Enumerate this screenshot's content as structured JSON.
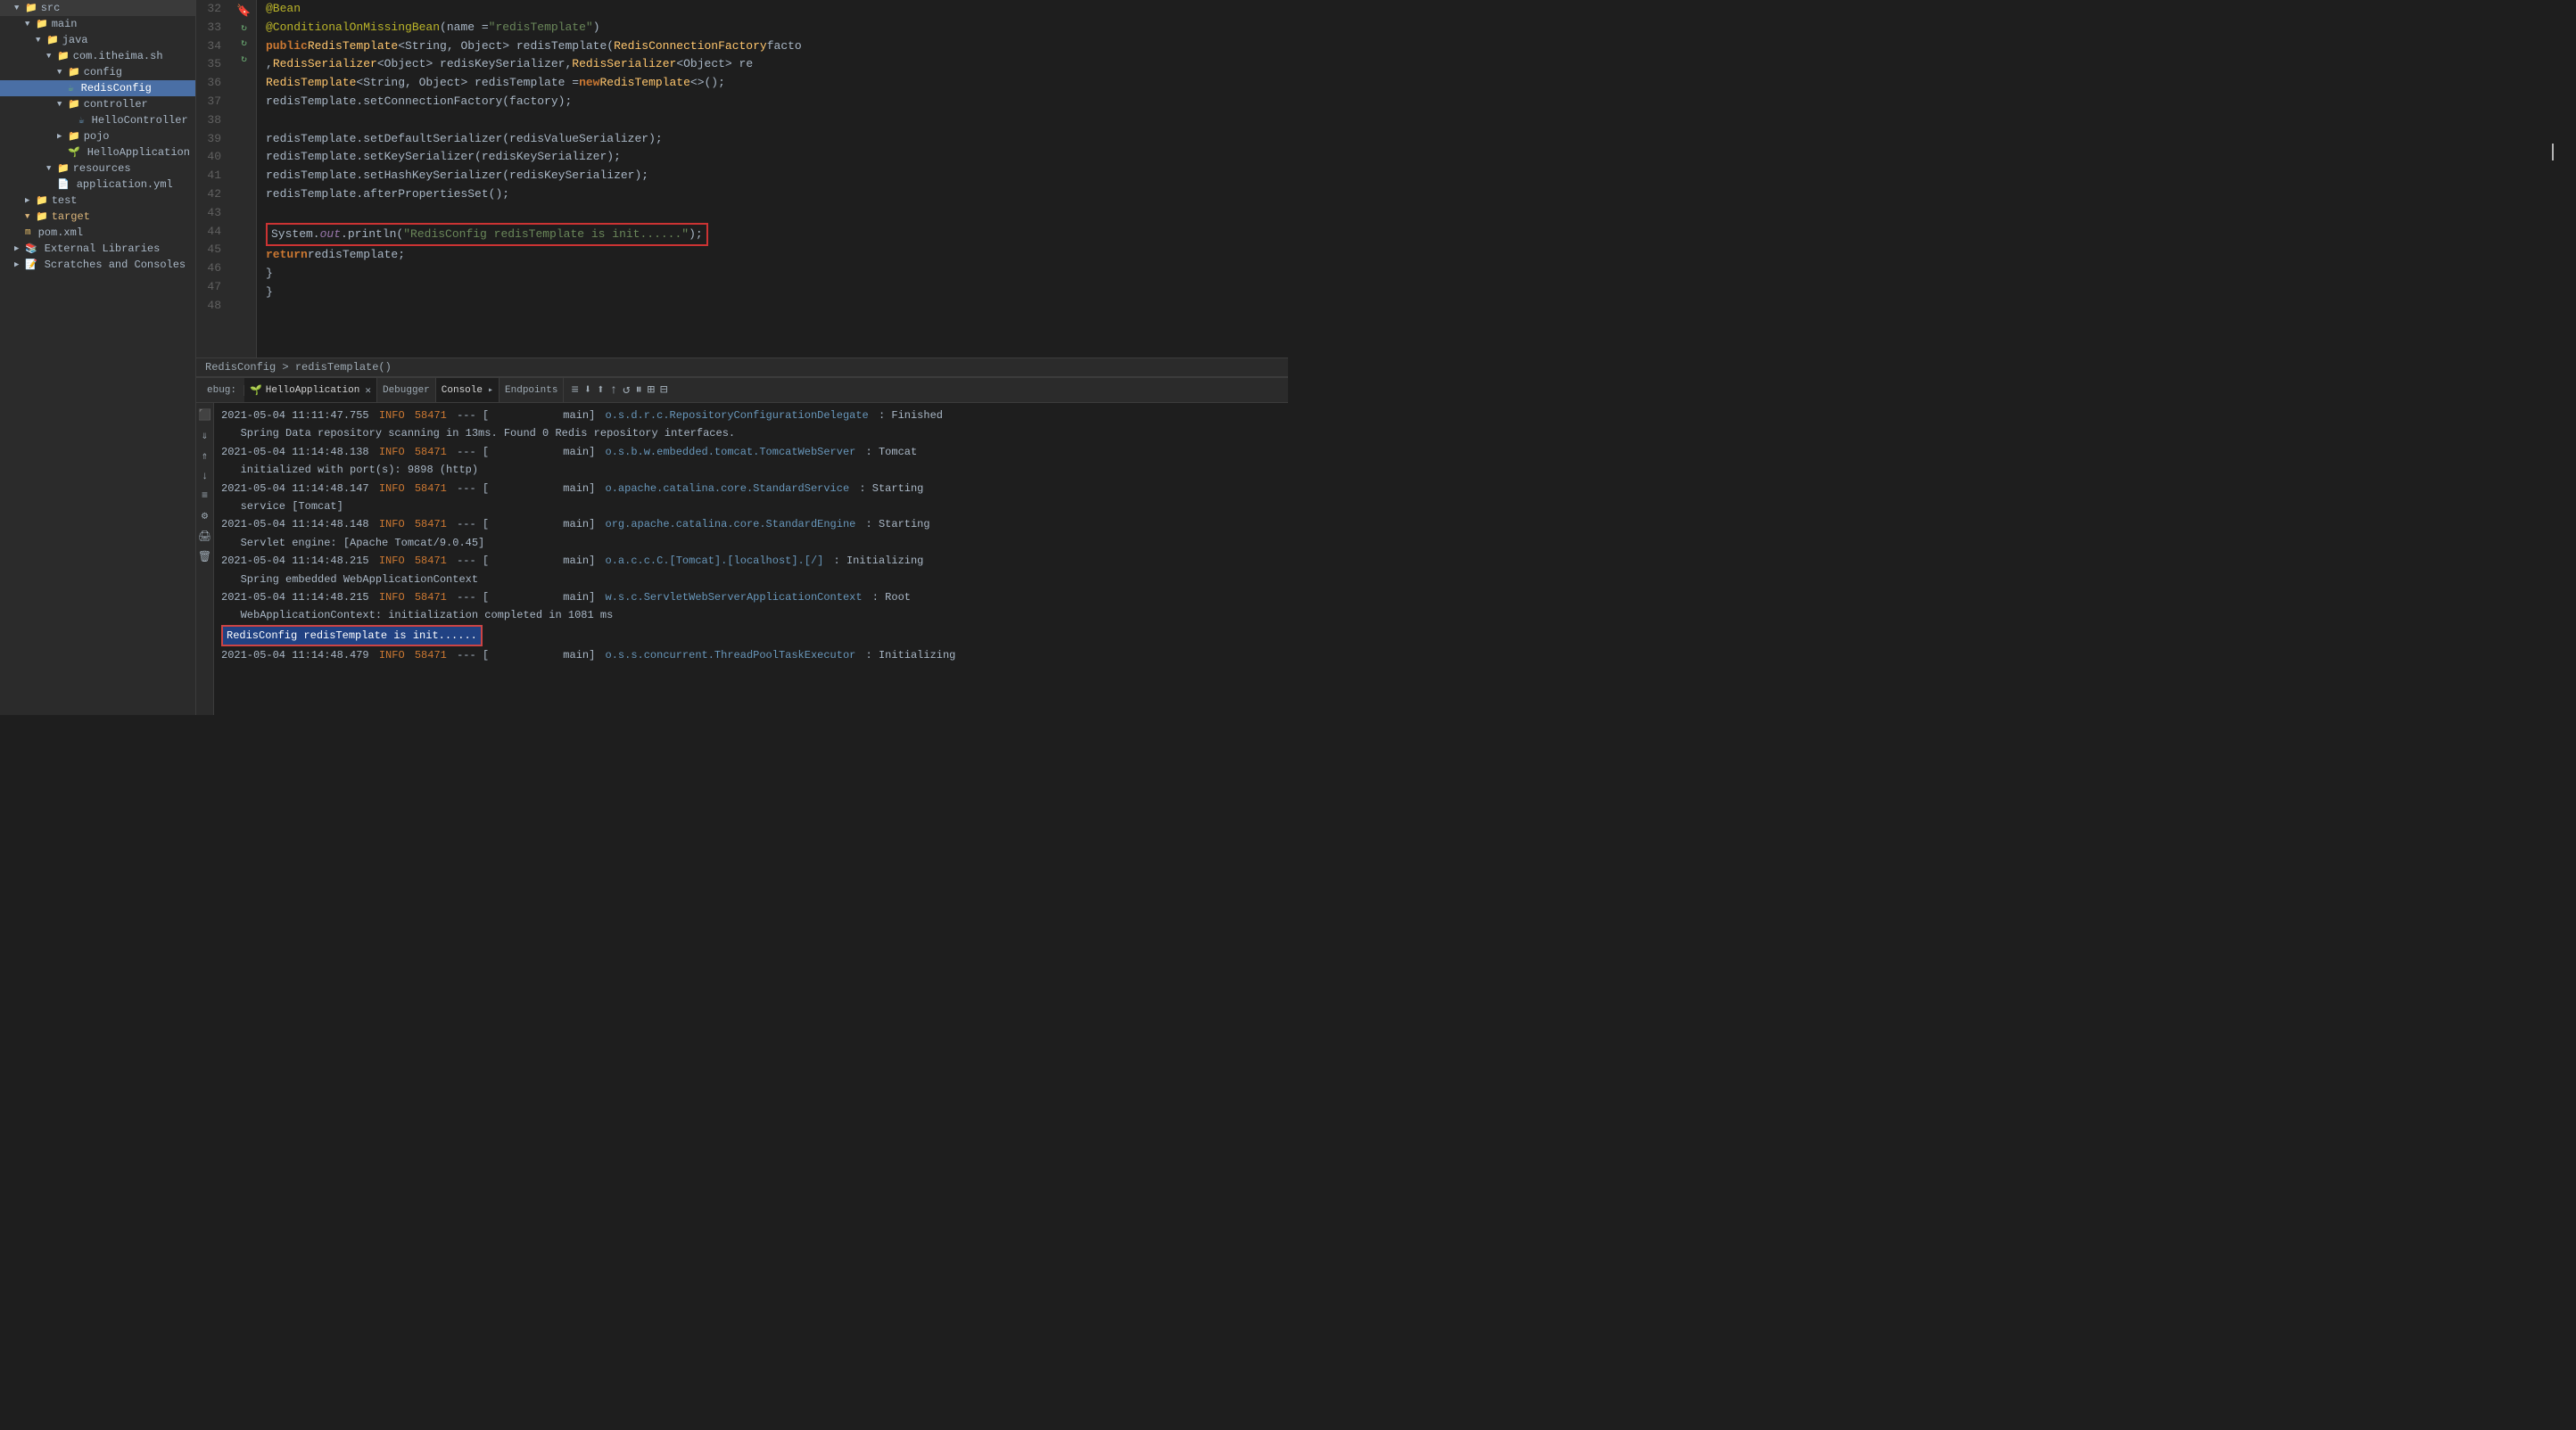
{
  "sidebar": {
    "items": [
      {
        "label": "src",
        "type": "folder",
        "indent": 0,
        "expanded": true
      },
      {
        "label": "main",
        "type": "folder",
        "indent": 1,
        "expanded": true
      },
      {
        "label": "java",
        "type": "folder",
        "indent": 2,
        "expanded": true
      },
      {
        "label": "com.itheima.sh",
        "type": "folder",
        "indent": 3,
        "expanded": true
      },
      {
        "label": "config",
        "type": "folder",
        "indent": 4,
        "expanded": true
      },
      {
        "label": "RedisConfig",
        "type": "java-selected",
        "indent": 5
      },
      {
        "label": "controller",
        "type": "folder",
        "indent": 4,
        "expanded": true
      },
      {
        "label": "HelloController",
        "type": "java",
        "indent": 5
      },
      {
        "label": "pojo",
        "type": "folder",
        "indent": 4,
        "expanded": false
      },
      {
        "label": "HelloApplication",
        "type": "spring",
        "indent": 4
      },
      {
        "label": "resources",
        "type": "folder",
        "indent": 3,
        "expanded": true
      },
      {
        "label": "application.yml",
        "type": "yaml",
        "indent": 4
      },
      {
        "label": "test",
        "type": "folder",
        "indent": 1,
        "expanded": false
      },
      {
        "label": "target",
        "type": "folder-open",
        "indent": 1,
        "expanded": false
      },
      {
        "label": "pom.xml",
        "type": "xml",
        "indent": 1
      },
      {
        "label": "External Libraries",
        "type": "folder",
        "indent": 0
      },
      {
        "label": "Scratches and Consoles",
        "type": "folder",
        "indent": 0
      }
    ]
  },
  "editor": {
    "lines": [
      {
        "num": 32,
        "content": "@Bean"
      },
      {
        "num": 33,
        "content": "@ConditionalOnMissingBean(name = \"redisTemplate\")"
      },
      {
        "num": 34,
        "content": "public RedisTemplate<String, Object> redisTemplate(RedisConnectionFactory facto"
      },
      {
        "num": 35,
        "content": "        , RedisSerializer<Object> redisKeySerializer, RedisSerializer<Object> re"
      },
      {
        "num": 36,
        "content": "    RedisTemplate<String, Object> redisTemplate = new RedisTemplate<>();"
      },
      {
        "num": 37,
        "content": "    redisTemplate.setConnectionFactory(factory);"
      },
      {
        "num": 38,
        "content": ""
      },
      {
        "num": 39,
        "content": "    redisTemplate.setDefaultSerializer(redisValueSerializer);"
      },
      {
        "num": 40,
        "content": "    redisTemplate.setKeySerializer(redisKeySerializer);"
      },
      {
        "num": 41,
        "content": "    redisTemplate.setHashKeySerializer(redisKeySerializer);"
      },
      {
        "num": 42,
        "content": "    redisTemplate.afterPropertiesSet();"
      },
      {
        "num": 43,
        "content": ""
      },
      {
        "num": 44,
        "content": "        System.out.println(\"RedisConfig redisTemplate is init......\");"
      },
      {
        "num": 45,
        "content": "        return redisTemplate;"
      },
      {
        "num": 46,
        "content": "    }"
      },
      {
        "num": 47,
        "content": "}"
      },
      {
        "num": 48,
        "content": ""
      }
    ],
    "breadcrumb": "RedisConfig > redisTemplate()"
  },
  "bottom": {
    "debug_label": "ebug:",
    "app_tab": "HelloApplication",
    "tabs": [
      "Debugger",
      "Console",
      "Endpoints"
    ],
    "active_tab": "Console",
    "console_lines": [
      {
        "date": "2021-05-04 11:11:47.755",
        "level": "INFO",
        "pid": "58471",
        "thread": "main",
        "class": "o.s.d.r.c.RepositoryConfigurationDelegate",
        "msg": ": Finished"
      },
      {
        "date": "",
        "level": "",
        "pid": "",
        "thread": "",
        "class": "",
        "msg": "   Spring Data repository scanning in 13ms. Found 0 Redis repository interfaces."
      },
      {
        "date": "2021-05-04 11:14:48.138",
        "level": "INFO",
        "pid": "58471",
        "thread": "main",
        "class": "o.s.b.w.embedded.tomcat.TomcatWebServer",
        "msg": ": Tomcat"
      },
      {
        "date": "",
        "level": "",
        "pid": "",
        "thread": "",
        "class": "",
        "msg": "   initialized with port(s): 9898 (http)"
      },
      {
        "date": "2021-05-04 11:14:48.147",
        "level": "INFO",
        "pid": "58471",
        "thread": "main",
        "class": "o.apache.catalina.core.StandardService",
        "msg": ": Starting"
      },
      {
        "date": "",
        "level": "",
        "pid": "",
        "thread": "",
        "class": "",
        "msg": "   service [Tomcat]"
      },
      {
        "date": "2021-05-04 11:14:48.148",
        "level": "INFO",
        "pid": "58471",
        "thread": "main",
        "class": "org.apache.catalina.core.StandardEngine",
        "msg": ": Starting"
      },
      {
        "date": "",
        "level": "",
        "pid": "",
        "thread": "",
        "class": "",
        "msg": "   Servlet engine: [Apache Tomcat/9.0.45]"
      },
      {
        "date": "2021-05-04 11:14:48.215",
        "level": "INFO",
        "pid": "58471",
        "thread": "main",
        "class": "o.a.c.c.C.[Tomcat].[localhost].[/]",
        "msg": ": Initializing"
      },
      {
        "date": "",
        "level": "",
        "pid": "",
        "thread": "",
        "class": "",
        "msg": "   Spring embedded WebApplicationContext"
      },
      {
        "date": "2021-05-04 11:14:48.215",
        "level": "INFO",
        "pid": "58471",
        "thread": "main",
        "class": "w.s.c.ServletWebServerApplicationContext",
        "msg": ": Root"
      },
      {
        "date": "",
        "level": "",
        "pid": "",
        "thread": "",
        "class": "",
        "msg": "   WebApplicationContext: initialization completed in 1081 ms"
      },
      {
        "date": "",
        "level": "",
        "pid": "",
        "thread": "",
        "class": "",
        "msg": "highlighted: RedisConfig redisTemplate is init......"
      },
      {
        "date": "2021-05-04 11:14:48.479",
        "level": "INFO",
        "pid": "58471",
        "thread": "main",
        "class": "o.s.s.concurrent.ThreadPoolTaskExecutor",
        "msg": ": Initializing"
      }
    ]
  }
}
